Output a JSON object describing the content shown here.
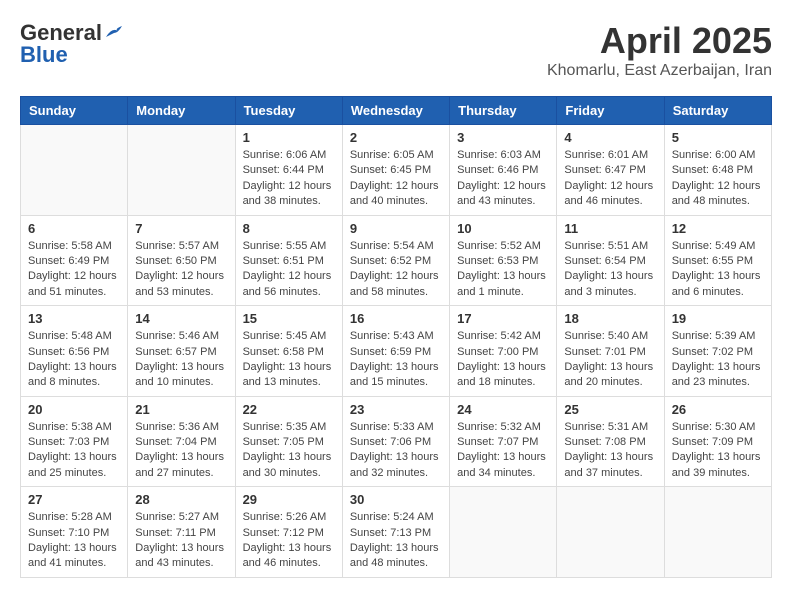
{
  "header": {
    "logo_line1": "General",
    "logo_line2": "Blue",
    "main_title": "April 2025",
    "subtitle": "Khomarlu, East Azerbaijan, Iran"
  },
  "weekdays": [
    "Sunday",
    "Monday",
    "Tuesday",
    "Wednesday",
    "Thursday",
    "Friday",
    "Saturday"
  ],
  "weeks": [
    [
      {
        "day": "",
        "info": ""
      },
      {
        "day": "",
        "info": ""
      },
      {
        "day": "1",
        "info": "Sunrise: 6:06 AM\nSunset: 6:44 PM\nDaylight: 12 hours\nand 38 minutes."
      },
      {
        "day": "2",
        "info": "Sunrise: 6:05 AM\nSunset: 6:45 PM\nDaylight: 12 hours\nand 40 minutes."
      },
      {
        "day": "3",
        "info": "Sunrise: 6:03 AM\nSunset: 6:46 PM\nDaylight: 12 hours\nand 43 minutes."
      },
      {
        "day": "4",
        "info": "Sunrise: 6:01 AM\nSunset: 6:47 PM\nDaylight: 12 hours\nand 46 minutes."
      },
      {
        "day": "5",
        "info": "Sunrise: 6:00 AM\nSunset: 6:48 PM\nDaylight: 12 hours\nand 48 minutes."
      }
    ],
    [
      {
        "day": "6",
        "info": "Sunrise: 5:58 AM\nSunset: 6:49 PM\nDaylight: 12 hours\nand 51 minutes."
      },
      {
        "day": "7",
        "info": "Sunrise: 5:57 AM\nSunset: 6:50 PM\nDaylight: 12 hours\nand 53 minutes."
      },
      {
        "day": "8",
        "info": "Sunrise: 5:55 AM\nSunset: 6:51 PM\nDaylight: 12 hours\nand 56 minutes."
      },
      {
        "day": "9",
        "info": "Sunrise: 5:54 AM\nSunset: 6:52 PM\nDaylight: 12 hours\nand 58 minutes."
      },
      {
        "day": "10",
        "info": "Sunrise: 5:52 AM\nSunset: 6:53 PM\nDaylight: 13 hours\nand 1 minute."
      },
      {
        "day": "11",
        "info": "Sunrise: 5:51 AM\nSunset: 6:54 PM\nDaylight: 13 hours\nand 3 minutes."
      },
      {
        "day": "12",
        "info": "Sunrise: 5:49 AM\nSunset: 6:55 PM\nDaylight: 13 hours\nand 6 minutes."
      }
    ],
    [
      {
        "day": "13",
        "info": "Sunrise: 5:48 AM\nSunset: 6:56 PM\nDaylight: 13 hours\nand 8 minutes."
      },
      {
        "day": "14",
        "info": "Sunrise: 5:46 AM\nSunset: 6:57 PM\nDaylight: 13 hours\nand 10 minutes."
      },
      {
        "day": "15",
        "info": "Sunrise: 5:45 AM\nSunset: 6:58 PM\nDaylight: 13 hours\nand 13 minutes."
      },
      {
        "day": "16",
        "info": "Sunrise: 5:43 AM\nSunset: 6:59 PM\nDaylight: 13 hours\nand 15 minutes."
      },
      {
        "day": "17",
        "info": "Sunrise: 5:42 AM\nSunset: 7:00 PM\nDaylight: 13 hours\nand 18 minutes."
      },
      {
        "day": "18",
        "info": "Sunrise: 5:40 AM\nSunset: 7:01 PM\nDaylight: 13 hours\nand 20 minutes."
      },
      {
        "day": "19",
        "info": "Sunrise: 5:39 AM\nSunset: 7:02 PM\nDaylight: 13 hours\nand 23 minutes."
      }
    ],
    [
      {
        "day": "20",
        "info": "Sunrise: 5:38 AM\nSunset: 7:03 PM\nDaylight: 13 hours\nand 25 minutes."
      },
      {
        "day": "21",
        "info": "Sunrise: 5:36 AM\nSunset: 7:04 PM\nDaylight: 13 hours\nand 27 minutes."
      },
      {
        "day": "22",
        "info": "Sunrise: 5:35 AM\nSunset: 7:05 PM\nDaylight: 13 hours\nand 30 minutes."
      },
      {
        "day": "23",
        "info": "Sunrise: 5:33 AM\nSunset: 7:06 PM\nDaylight: 13 hours\nand 32 minutes."
      },
      {
        "day": "24",
        "info": "Sunrise: 5:32 AM\nSunset: 7:07 PM\nDaylight: 13 hours\nand 34 minutes."
      },
      {
        "day": "25",
        "info": "Sunrise: 5:31 AM\nSunset: 7:08 PM\nDaylight: 13 hours\nand 37 minutes."
      },
      {
        "day": "26",
        "info": "Sunrise: 5:30 AM\nSunset: 7:09 PM\nDaylight: 13 hours\nand 39 minutes."
      }
    ],
    [
      {
        "day": "27",
        "info": "Sunrise: 5:28 AM\nSunset: 7:10 PM\nDaylight: 13 hours\nand 41 minutes."
      },
      {
        "day": "28",
        "info": "Sunrise: 5:27 AM\nSunset: 7:11 PM\nDaylight: 13 hours\nand 43 minutes."
      },
      {
        "day": "29",
        "info": "Sunrise: 5:26 AM\nSunset: 7:12 PM\nDaylight: 13 hours\nand 46 minutes."
      },
      {
        "day": "30",
        "info": "Sunrise: 5:24 AM\nSunset: 7:13 PM\nDaylight: 13 hours\nand 48 minutes."
      },
      {
        "day": "",
        "info": ""
      },
      {
        "day": "",
        "info": ""
      },
      {
        "day": "",
        "info": ""
      }
    ]
  ]
}
